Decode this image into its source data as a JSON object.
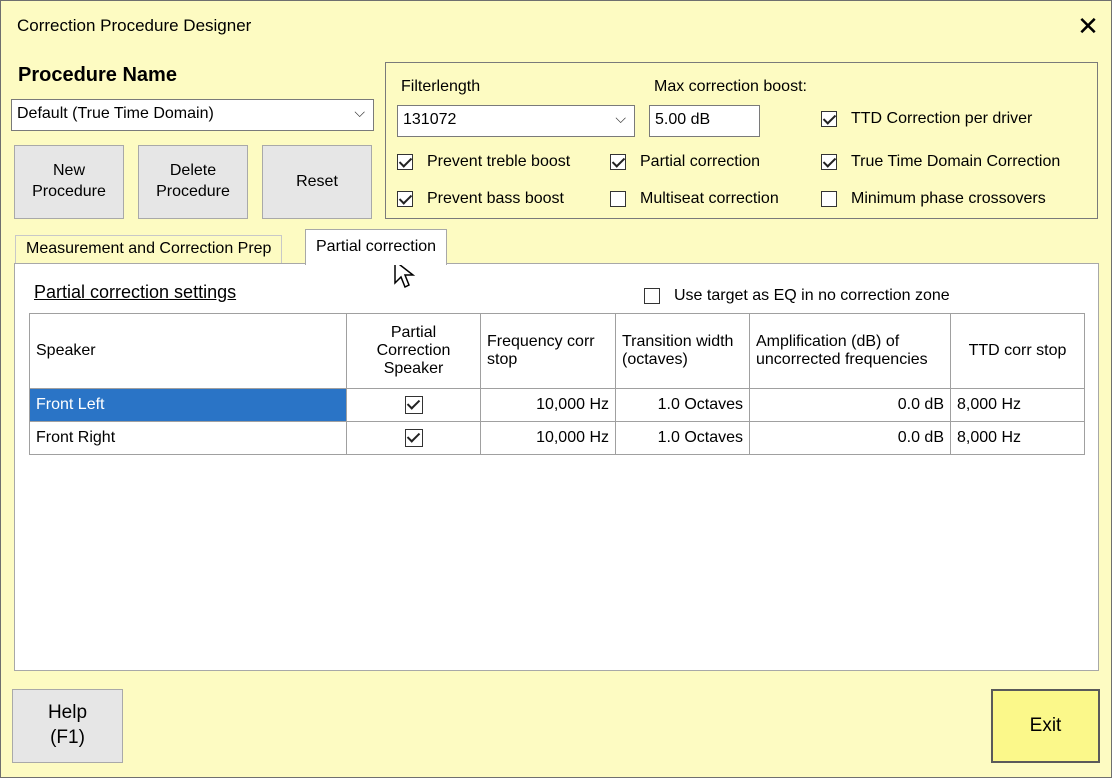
{
  "window": {
    "title": "Correction Procedure Designer",
    "close_label": "✕"
  },
  "procedure": {
    "label": "Procedure Name",
    "selected": "Default (True Time Domain)",
    "buttons": {
      "new": "New\nProcedure",
      "delete": "Delete\nProcedure",
      "reset": "Reset"
    }
  },
  "options": {
    "filterlength_label": "Filterlength",
    "filterlength_value": "131072",
    "max_boost_label": "Max correction boost:",
    "max_boost_value": "5.00 dB",
    "checkboxes": [
      {
        "label": "TTD Correction per driver",
        "checked": true
      },
      {
        "label": "Prevent treble boost",
        "checked": true
      },
      {
        "label": "Partial correction",
        "checked": true
      },
      {
        "label": "True Time Domain Correction",
        "checked": true
      },
      {
        "label": "Prevent bass boost",
        "checked": true
      },
      {
        "label": "Multiseat correction",
        "checked": false
      },
      {
        "label": "Minimum phase crossovers",
        "checked": false
      }
    ]
  },
  "tabs": [
    {
      "label": "Measurement and Correction Prep",
      "active": false
    },
    {
      "label": "Partial correction",
      "active": true
    }
  ],
  "partial": {
    "title": "Partial correction settings",
    "use_target_label": "Use target as EQ in no correction zone",
    "use_target_checked": false,
    "columns": [
      "Speaker",
      "Partial Correction Speaker",
      "Frequency corr stop",
      "Transition width (octaves)",
      "Amplification (dB)  of uncorrected frequencies",
      "TTD corr stop"
    ],
    "rows": [
      {
        "speaker": "Front Left",
        "partial": true,
        "freq": "10,000 Hz",
        "transition": "1.0 Octaves",
        "amp": "0.0 dB",
        "ttd": "8,000 Hz"
      },
      {
        "speaker": "Front Right",
        "partial": true,
        "freq": "10,000 Hz",
        "transition": "1.0 Octaves",
        "amp": "0.0 dB",
        "ttd": "8,000 Hz"
      }
    ]
  },
  "footer": {
    "help": "Help\n(F1)",
    "exit": "Exit"
  },
  "colors": {
    "background": "#fdfbc2",
    "selection": "#2a74c6",
    "exit_button": "#fbf88a"
  }
}
